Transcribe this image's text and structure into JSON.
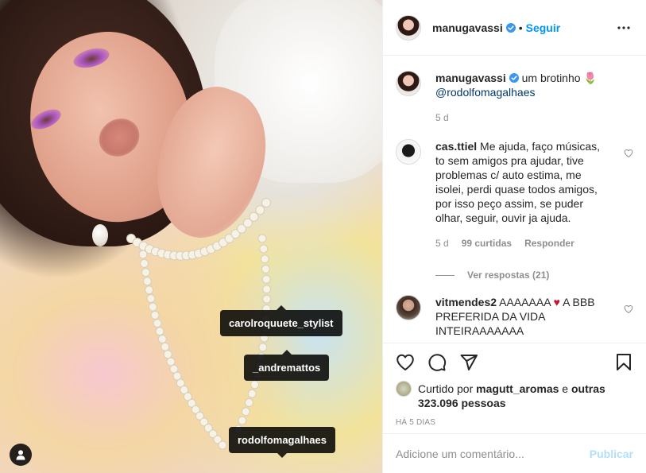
{
  "post": {
    "photo_tags": [
      "carolroquuete_stylist",
      "_andremattos",
      "rodolfomagalhaes"
    ]
  },
  "header": {
    "username": "manugavassi",
    "separator": "•",
    "follow_label": "Seguir"
  },
  "caption": {
    "username": "manugavassi",
    "text": "um brotinho 🌷",
    "mention": "@rodolfomagalhaes",
    "time": "5 d"
  },
  "comments": [
    {
      "username": "cas.ttiel",
      "text": "Me ajuda, faço músicas, to sem amigos pra ajudar, tive problemas c/ auto estima, me isolei, perdi quase todos amigos, por isso peço assim, se puder olhar, seguir, ouvir ja ajuda.",
      "time": "5 d",
      "likes": "99 curtidas",
      "reply_label": "Responder",
      "view_replies": "Ver respostas (21)"
    },
    {
      "username": "vitmendes2",
      "text_before": "AAAAAAA ",
      "heart": "♥",
      "text_after": " A BBB PREFERIDA DA VIDA INTEIRAAAAAAA"
    }
  ],
  "likes": {
    "prefix": "Curtido por ",
    "user": "magutt_aromas",
    "middle": " e ",
    "others": "outras 323.096 pessoas"
  },
  "time_ago": "HÁ 5 DIAS",
  "add_comment": {
    "placeholder": "Adicione um comentário...",
    "publish_label": "Publicar"
  },
  "colors": {
    "link_blue": "#0095f6",
    "publish_disabled": "#b2dffc",
    "secondary_text": "#8e8e8e",
    "heart_red": "#ed4956"
  }
}
